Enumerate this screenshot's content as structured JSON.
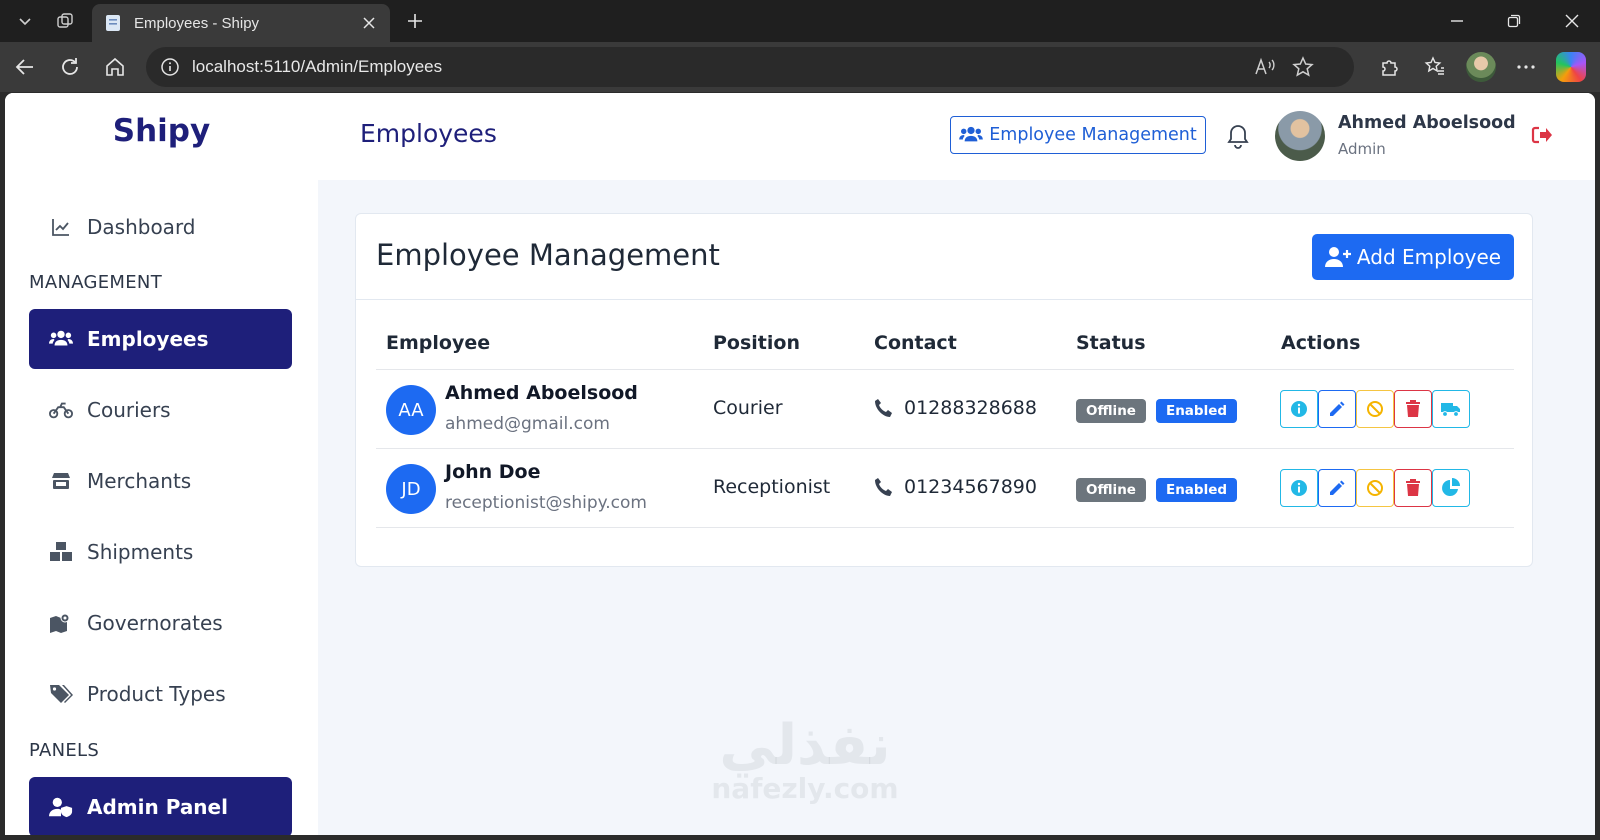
{
  "browser": {
    "tab_title": "Employees - Shipy",
    "url": "localhost:5110/Admin/Employees"
  },
  "sidebar": {
    "brand": "Shipy",
    "dashboard": "Dashboard",
    "section_management": "MANAGEMENT",
    "items": [
      {
        "label": "Employees",
        "icon": "users-icon",
        "active": true
      },
      {
        "label": "Couriers",
        "icon": "motorcycle-icon"
      },
      {
        "label": "Merchants",
        "icon": "store-icon"
      },
      {
        "label": "Shipments",
        "icon": "boxes-icon"
      },
      {
        "label": "Governorates",
        "icon": "map-icon"
      },
      {
        "label": "Product Types",
        "icon": "tags-icon"
      }
    ],
    "section_panels": "PANELS",
    "panel_item": "Admin Panel"
  },
  "topbar": {
    "page_title": "Employees",
    "section_button": "Employee Management",
    "user_name": "Ahmed Aboelsood",
    "user_role": "Admin"
  },
  "card": {
    "title": "Employee Management",
    "add_button": "Add Employee",
    "columns": [
      "Employee",
      "Position",
      "Contact",
      "Status",
      "Actions"
    ],
    "rows": [
      {
        "initials": "AA",
        "name": "Ahmed Aboelsood",
        "email": "ahmed@gmail.com",
        "position": "Courier",
        "phone": "01288328688",
        "presence": "Offline",
        "state": "Enabled",
        "extra_action_icon": "truck-icon"
      },
      {
        "initials": "JD",
        "name": "John Doe",
        "email": "receptionist@shipy.com",
        "position": "Receptionist",
        "phone": "01234567890",
        "presence": "Offline",
        "state": "Enabled",
        "extra_action_icon": "chart-pie-icon"
      }
    ]
  },
  "colors": {
    "brand_navy": "#1e1f7a",
    "primary_blue": "#1d6af2",
    "info_cyan": "#22b8e6",
    "warning_yellow": "#f5c542",
    "danger_red": "#dc3545",
    "secondary_gray": "#6c757d"
  },
  "watermark": {
    "arabic": "نفذلي",
    "latin": "nafezly.com"
  }
}
